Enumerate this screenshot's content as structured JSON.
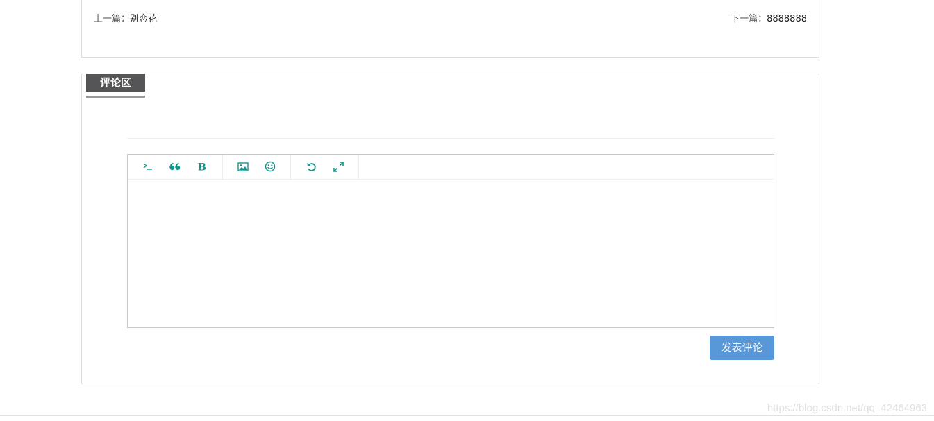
{
  "article_nav": {
    "prev_label": "上一篇：",
    "prev_title": "别恋花",
    "next_label": "下一篇：",
    "next_title": "8888888"
  },
  "comments": {
    "section_title": "评论区",
    "toolbar": {
      "groups": [
        [
          "code-icon",
          "quote-icon",
          "bold-icon"
        ],
        [
          "image-icon",
          "emoji-icon"
        ],
        [
          "undo-icon",
          "fullscreen-icon"
        ]
      ]
    },
    "editor_value": "",
    "submit_label": "发表评论"
  },
  "watermark": "https://blog.csdn.net/qq_42464963",
  "colors": {
    "accent": "#14968c",
    "button": "#5897d8",
    "title_bg": "#555557",
    "border": "#dcdcdc"
  }
}
